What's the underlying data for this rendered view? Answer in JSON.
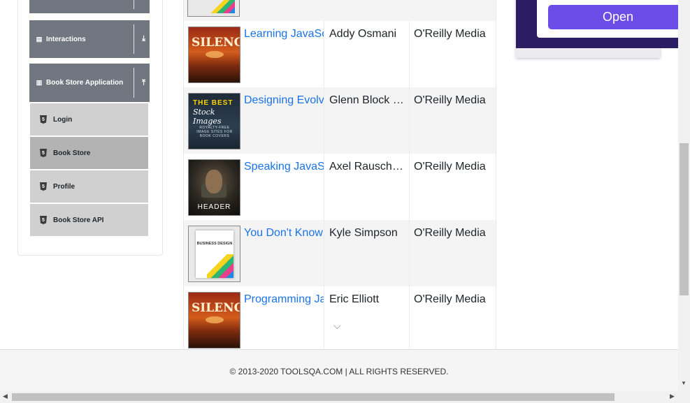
{
  "sidebar": {
    "groups": [
      {
        "label": "Interactions",
        "icon": "list-icon",
        "arrow": "⤓"
      },
      {
        "label": "Book Store Application",
        "icon": "books-icon",
        "arrow": "⤒"
      }
    ],
    "items": [
      {
        "label": "Login",
        "active": false
      },
      {
        "label": "Book Store",
        "active": true
      },
      {
        "label": "Profile",
        "active": false
      },
      {
        "label": "Book Store API",
        "active": false
      }
    ]
  },
  "books": {
    "rows": [
      {
        "title": "Learning JavaScript Design Patterns",
        "author": "Addy Osmani",
        "publisher": "O'Reilly Media",
        "cover": "silence-cover",
        "cover_title": "SILENCE"
      },
      {
        "title": "Designing Evolvable Web APIs with ASP.NET",
        "author": "Glenn Block et al.",
        "publisher": "O'Reilly Media",
        "cover": "stock-images-cover",
        "cover_title": "THE BEST",
        "cover_sub": "Stock Images",
        "cover_note": "ROYALTY-FREE IMAGE SITES FOR BOOK COVERS"
      },
      {
        "title": "Speaking JavaScript",
        "author": "Axel Rauschmayer",
        "publisher": "O'Reilly Media",
        "cover": "header-cover",
        "cover_title": "HEADER"
      },
      {
        "title": "You Don't Know JS",
        "author": "Kyle Simpson",
        "publisher": "O'Reilly Media",
        "cover": "business-design-cover",
        "cover_title": "BUSINESS DESIGN"
      },
      {
        "title": "Programming JavaScript Applications",
        "author": "Eric Elliott",
        "publisher": "O'Reilly Media",
        "cover": "silence-cover",
        "cover_title": "SILENCE"
      }
    ]
  },
  "ad": {
    "button_label": "Open"
  },
  "footer": {
    "text": "© 2013-2020 TOOLSQA.COM | ALL RIGHTS RESERVED."
  }
}
